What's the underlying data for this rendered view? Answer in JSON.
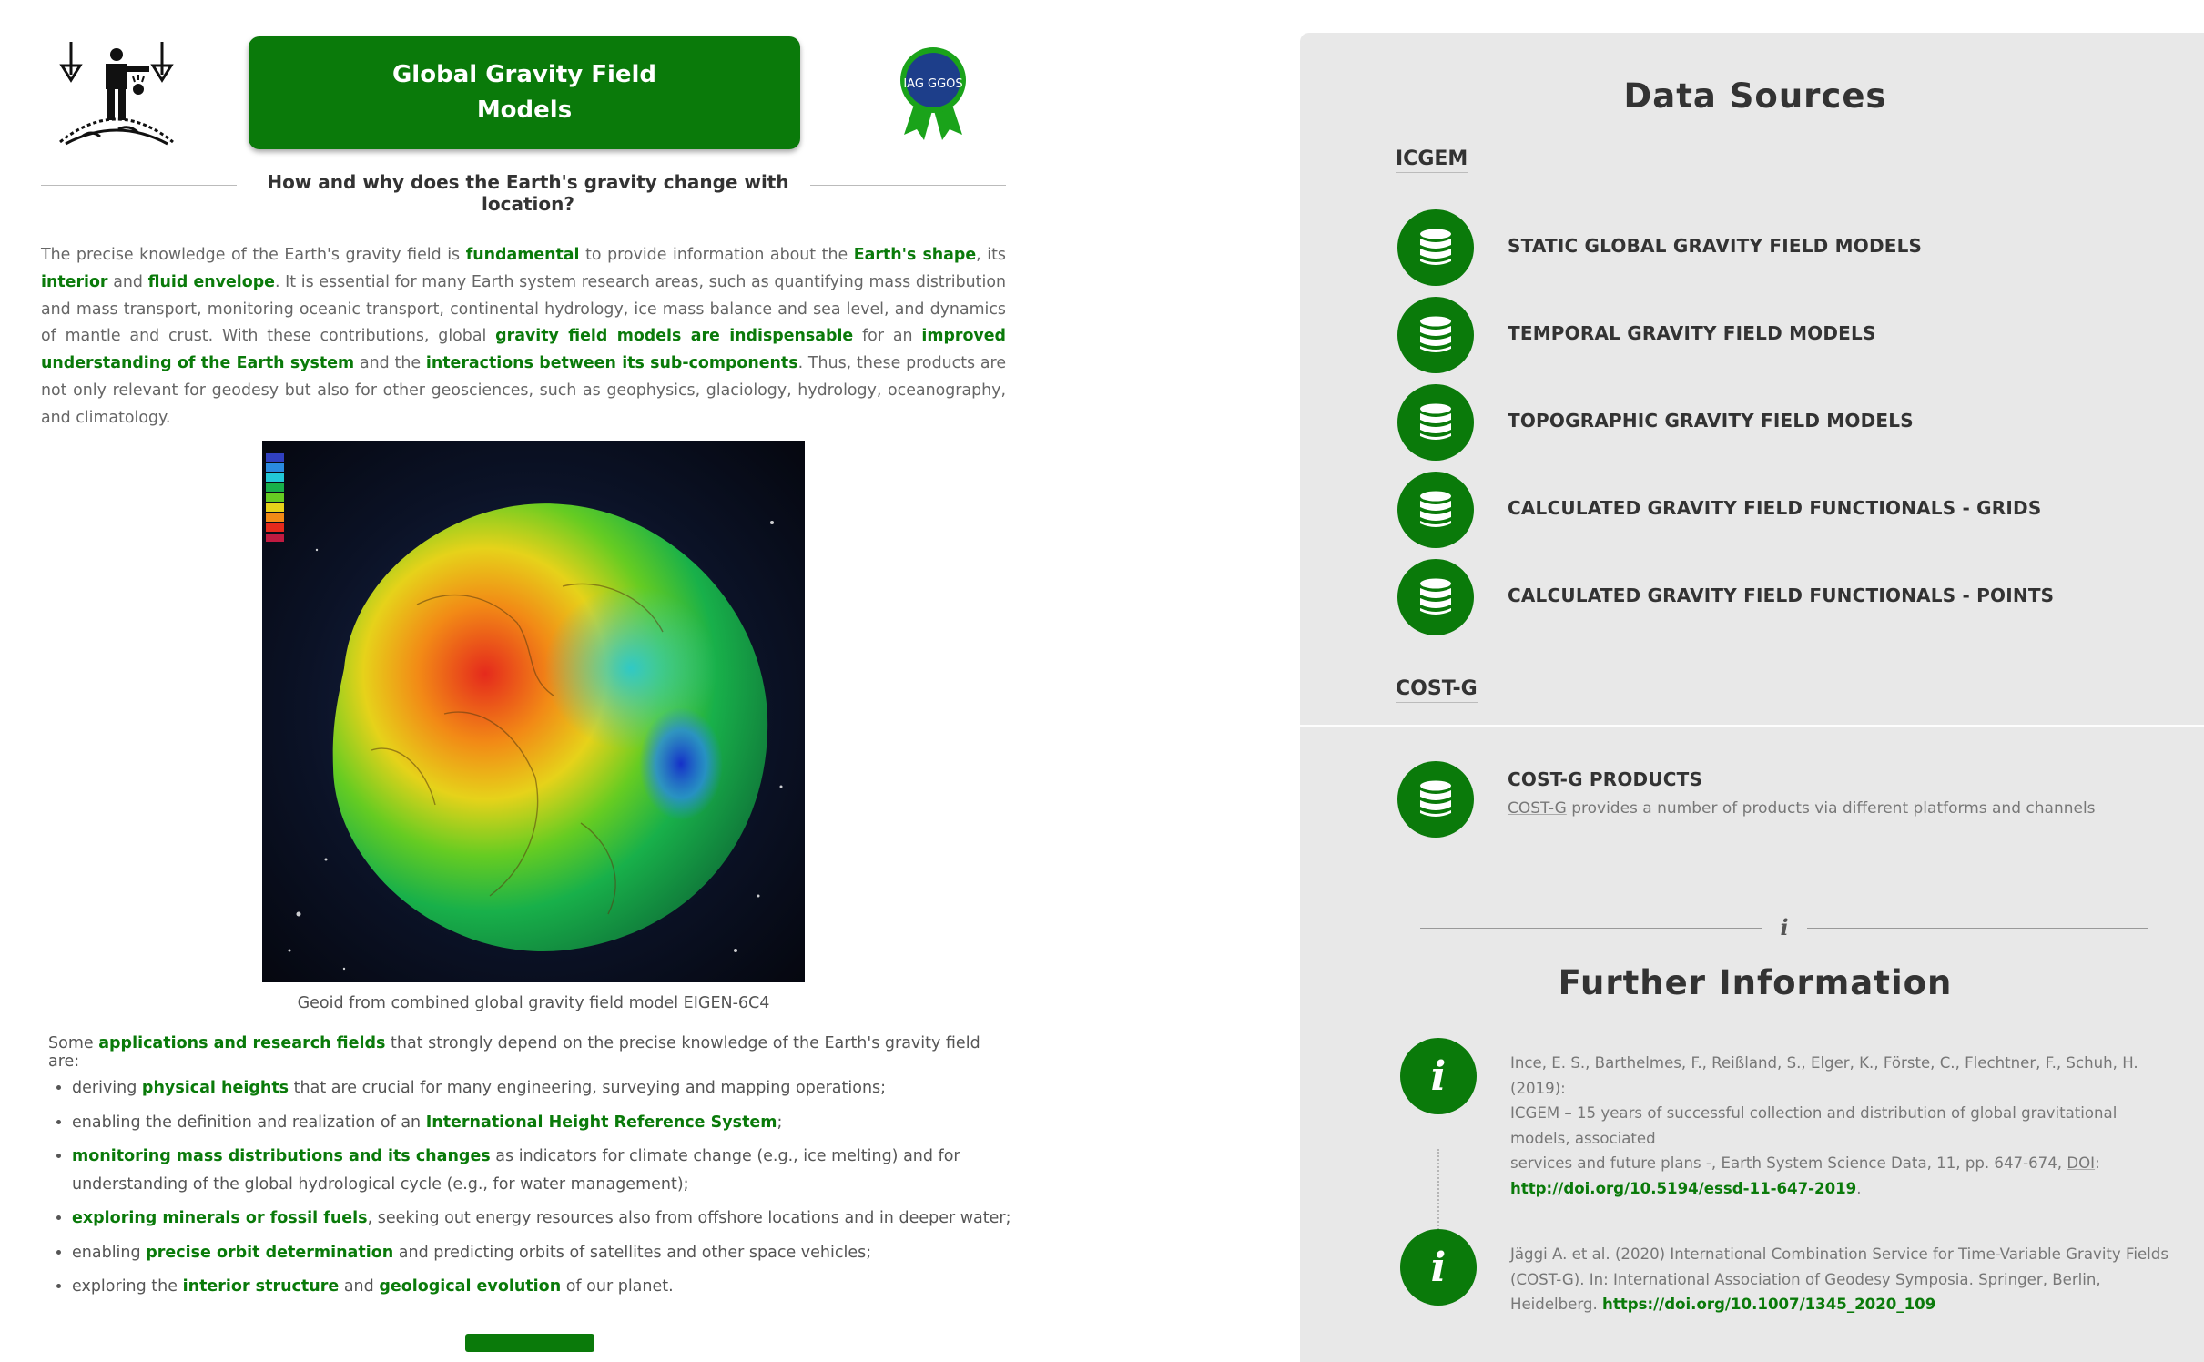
{
  "header": {
    "title": "Global Gravity Field Models",
    "subtitle": "How and why does the Earth's gravity change with location?",
    "badge_text": "IAG GGOS"
  },
  "intro": {
    "t1": "The precise knowledge of the Earth's gravity field is ",
    "k1": "fundamental",
    "t2": " to provide information about the ",
    "k2": "Earth's shape",
    "t3": ", its ",
    "k3": "interior",
    "t4": " and ",
    "k4": "fluid envelope",
    "t5": ". It is essential for many Earth system research areas, such as quantifying mass distribution and mass transport, monitoring oceanic transport, continental hydrology, ice mass balance and sea level, and dynamics of mantle and crust. With these contributions, global ",
    "k5": "gravity field models are indispensable",
    "t6": " for an ",
    "k6": "improved understanding of the Earth system",
    "t7": " and the ",
    "k7": "interactions between its sub-components",
    "t8": ". Thus, these products are not only relevant for geodesy but also for other geosciences, such as geophysics, glaciology, hydrology, oceanography, and climatology."
  },
  "figure": {
    "caption": "Geoid from combined global gravity field model EIGEN-6C4"
  },
  "applications": {
    "pre": "Some ",
    "key": "applications and research fields",
    "post": " that strongly depend on the precise knowledge of the Earth's gravity field are:",
    "items": [
      {
        "a": "deriving ",
        "k": "physical heights",
        "b": " that are crucial for many engineering, surveying and mapping operations;"
      },
      {
        "a": "enabling the definition and realization of an ",
        "k": "International Height Reference System",
        "b": ";"
      },
      {
        "a": "",
        "k": "monitoring mass distributions and its changes",
        "b": " as indicators for climate change (e.g., ice melting) and for understanding of the global hydrological cycle (e.g., for water management);"
      },
      {
        "a": "",
        "k": "exploring minerals or fossil fuels",
        "b": ", seeking out energy resources also from offshore locations and in deeper water;"
      },
      {
        "a": "enabling ",
        "k": "precise orbit determination",
        "b": " and predicting orbits of satellites and other space vehicles;"
      },
      {
        "a": "exploring the ",
        "k": "interior structure",
        "b": " and ",
        "k2": "geological evolution",
        "c": " of our planet."
      }
    ]
  },
  "sources": {
    "heading": "Data Sources",
    "group1": "ICGEM",
    "items": [
      "STATIC GLOBAL GRAVITY FIELD MODELS",
      "TEMPORAL GRAVITY FIELD MODELS",
      "TOPOGRAPHIC GRAVITY FIELD MODELS",
      "CALCULATED GRAVITY FIELD FUNCTIONALS - GRIDS",
      "CALCULATED GRAVITY FIELD FUNCTIONALS - POINTS"
    ],
    "group2": "COST-G",
    "cost_g": {
      "label": "COST-G PRODUCTS",
      "sub_link": "COST-G",
      "sub_text": " provides a number of products via different platforms and channels"
    }
  },
  "further": {
    "divider_glyph": "i",
    "heading": "Further Information",
    "ref1": {
      "l1": "Ince, E. S., Barthelmes, F., Reißland, S., Elger, K., Förste, C., Flechtner, F., Schuh, H. (2019):",
      "l2": "ICGEM – 15 years of successful collection and distribution of global gravitational models, associated",
      "l3": "services and future plans -, Earth System Science Data, 11, pp. 647-674, ",
      "doi_label": "DOI",
      "sep": ": ",
      "link": "http://doi.org/10.5194/essd-11-647-2019",
      "end": "."
    },
    "ref2": {
      "t1": "Jäggi A. et al. (2020) International Combination Service for Time-Variable Gravity Fields (",
      "u1": "COST-G",
      "t2": "). In: International Association of Geodesy Symposia. Springer, Berlin, Heidelberg. ",
      "link": "https://doi.org/10.1007/1345_2020_109"
    }
  },
  "colors": {
    "brand_green": "#0a7a0a",
    "panel_bg": "#e8e8e8"
  }
}
